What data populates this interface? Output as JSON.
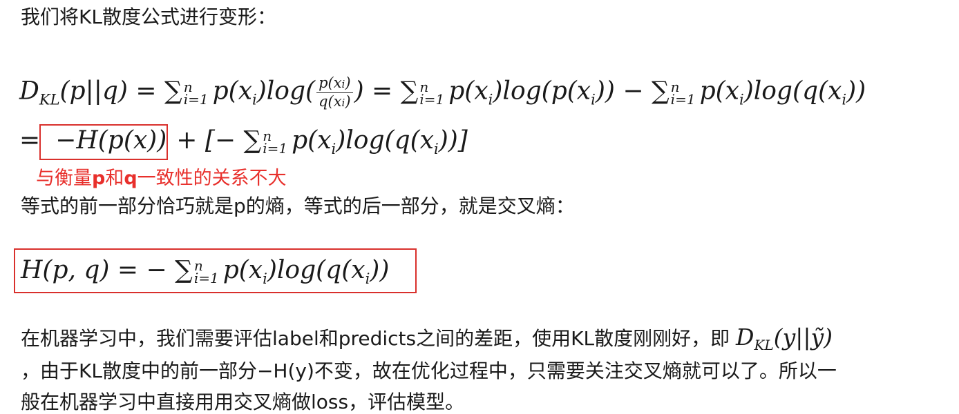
{
  "intro": "我们将KL散度公式进行变形：",
  "formula1_line1": {
    "lhs": "D",
    "lhs_sub": "KL",
    "lhs_args": "(p||q) = ",
    "sum": "∑",
    "sum_sup": "n",
    "sum_sub": "i=1",
    "term1": "p(x",
    "term1b": ")log(",
    "frac_num": "p(x",
    "frac_den": "q(x",
    "after_frac": ") = ",
    "term2": "p(x",
    "term2b": ")log(p(x",
    "term2c": ")) − ",
    "term3": "p(x",
    "term3b": ")log(q(x",
    "term3c": "))",
    "i": "i"
  },
  "formula1_line2": {
    "eq": "=",
    "boxed": "−H(p(x))",
    "rest_a": "+ [− ",
    "rest_b": "p(x",
    "rest_c": ")log(q(x",
    "rest_d": "))]"
  },
  "annotation": {
    "a": "与衡量",
    "p": "p",
    "b": "和",
    "q": "q",
    "c": "一致性的关系不大"
  },
  "para2": "等式的前一部分恰巧就是p的熵，等式的后一部分，就是交叉熵：",
  "formula2": {
    "lhs": "H(p, q) = − ",
    "a": "p(x",
    "b": ")log(q(x",
    "c": "))"
  },
  "para3_line1": "在机器学习中，我们需要评估label和predicts之间的差距，使用KL散度刚刚好，即",
  "para3_math": {
    "d": "D",
    "sub": "KL",
    "args_a": "(y||",
    "ytilde": "ỹ",
    "args_b": ")"
  },
  "para3_line2": "，由于KL散度中的前一部分−H(y)不变，故在优化过程中，只需要关注交叉熵就可以了。所以一",
  "para3_line3": "般在机器学习中直接用用交叉熵做loss，评估模型。"
}
